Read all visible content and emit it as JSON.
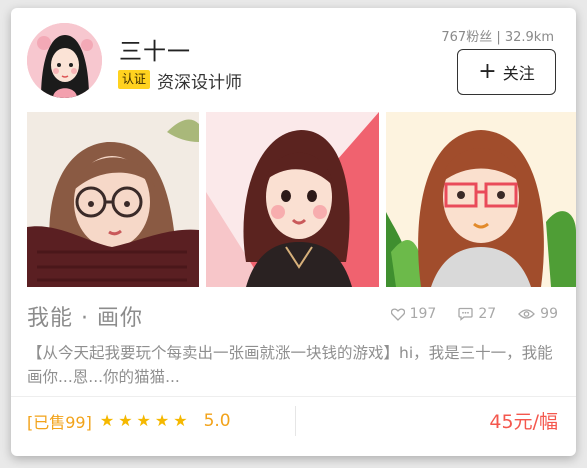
{
  "designer": {
    "name": "三十一",
    "badge": "认证",
    "title": "资深设计师",
    "stats": "767粉丝 | 32.9km",
    "follow_label": "关注"
  },
  "work": {
    "title": "我能 · 画你",
    "likes": "197",
    "comments": "27",
    "views": "99",
    "description": "【从今天起我要玩个每卖出一张画就涨一块钱的游戏】hi，我是三十一，我能画你...恩...你的猫猫..."
  },
  "footer": {
    "sold": "[已售99]",
    "stars": 5,
    "rating": "5.0",
    "price": "45元/幅"
  },
  "colors": {
    "accent_orange": "#f2a31b",
    "star_yellow": "#f5b800",
    "badge_yellow": "#ffd21f",
    "price_red": "#f4574d"
  }
}
